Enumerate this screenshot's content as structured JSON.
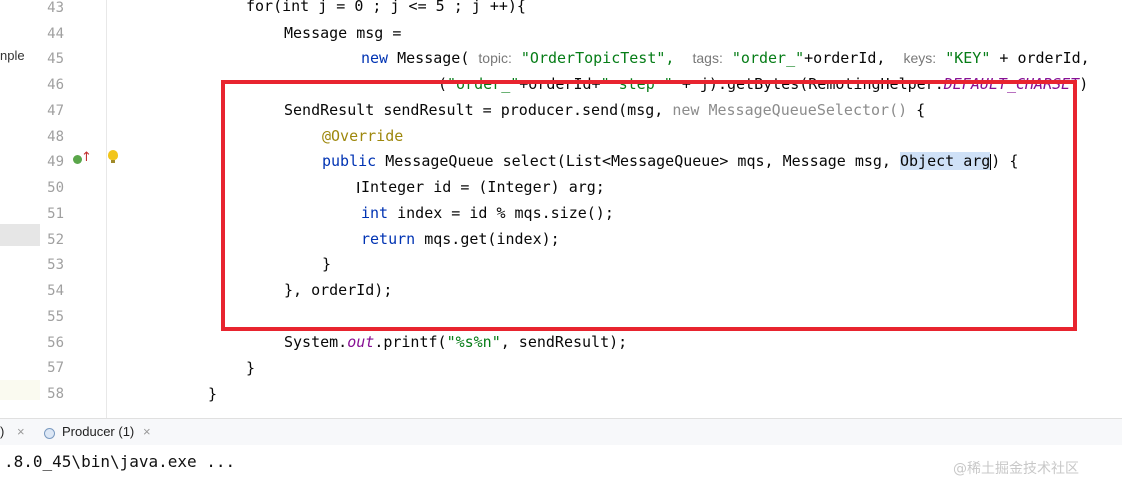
{
  "project_panel": {
    "label": "nple"
  },
  "editor": {
    "line_numbers": [
      "43",
      "44",
      "45",
      "46",
      "47",
      "48",
      "49",
      "50",
      "51",
      "52",
      "53",
      "54",
      "55",
      "56",
      "57",
      "58"
    ],
    "code": {
      "l43": "for(int j = 0 ; j <= 5 ; j ++){",
      "l44": "Message msg =",
      "l45_new": "new",
      "l45_class": "Message(",
      "l45_hint_topic": "topic:",
      "l45_topic": "\"OrderTopicTest\",",
      "l45_hint_tags": "tags:",
      "l45_tags": "\"order_\"",
      "l45_tags_rest": "+orderId,",
      "l45_hint_keys": "keys:",
      "l45_keys": "\"KEY\"",
      "l45_keys_rest": "+ orderId,",
      "l46_a": "(",
      "l46_str1": "\"order_\"",
      "l46_b": "+orderId+",
      "l46_str2": "\" step \"",
      "l46_c": "+ j).getBytes(RemotingHelper.",
      "l46_const": "DEFAULT_CHARSET",
      "l46_d": ")",
      "l47_a": "SendResult sendResult = producer.send(msg,",
      "l47_gray": "new MessageQueueSelector()",
      "l47_b": "{",
      "l48": "@Override",
      "l49_kw": "public",
      "l49_a": "MessageQueue select(List<MessageQueue> mqs, Message msg,",
      "l49_sel": "Object arg",
      "l49_b": ") {",
      "l50": "Integer id = (Integer) arg;",
      "l51_kw": "int",
      "l51_rest": "index = id % mqs.size();",
      "l52_kw": "return",
      "l52_rest": "mqs.get(index);",
      "l53": "}",
      "l54": "}, orderId);",
      "l56_a": "System.",
      "l56_out": "out",
      "l56_b": ".printf(",
      "l56_str": "\"%s%n\"",
      "l56_c": ", sendResult);",
      "l57": "}",
      "l58": "}"
    }
  },
  "run_tabs": {
    "prev_tab_fragment": ")",
    "prev_close": "×",
    "active_tab": "Producer (1)",
    "active_close": "×"
  },
  "console": {
    "line": ".8.0_45\\bin\\java.exe ..."
  },
  "watermark": "@稀土掘金技术社区",
  "colors": {
    "highlight_box": "#e8242f",
    "keyword": "#0033b3",
    "string": "#067d17",
    "annotation": "#9e880d"
  },
  "icons": {
    "run": "run-gutter-icon",
    "implements": "implements-arrow-icon",
    "intention": "lightbulb-icon",
    "tab": "run-config-icon"
  }
}
